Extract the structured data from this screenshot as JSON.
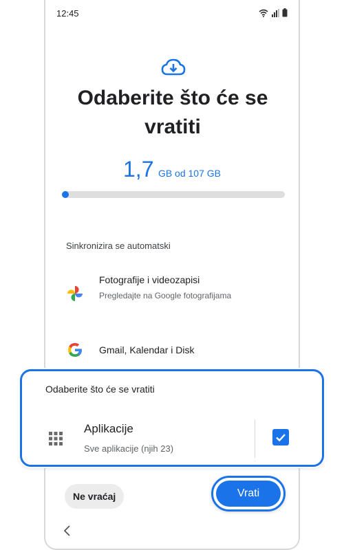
{
  "status_bar": {
    "time": "12:45"
  },
  "page": {
    "title": "Odaberite što će se vratiti",
    "storage_used": "1,7",
    "storage_total": "GB od 107 GB",
    "progress_fraction": 0.016
  },
  "sync": {
    "section_label": "Sinkronizira se automatski",
    "items": [
      {
        "title": "Fotografije i videozapisi",
        "subtitle": "Pregledajte na Google fotografijama",
        "icon": "google-photos-icon"
      },
      {
        "title": "Gmail, Kalendar i Disk",
        "icon": "google-icon"
      }
    ]
  },
  "select_card": {
    "title": "Odaberite što će se vratiti",
    "option": {
      "title": "Aplikacije",
      "subtitle": "Sve aplikacije (njih 23)",
      "checked": true,
      "icon": "apps-grid-icon"
    }
  },
  "buttons": {
    "skip": "Ne vraćaj",
    "restore": "Vrati"
  },
  "colors": {
    "accent": "#1a73e8",
    "text": "#202124",
    "secondary_text": "#5f6368"
  }
}
